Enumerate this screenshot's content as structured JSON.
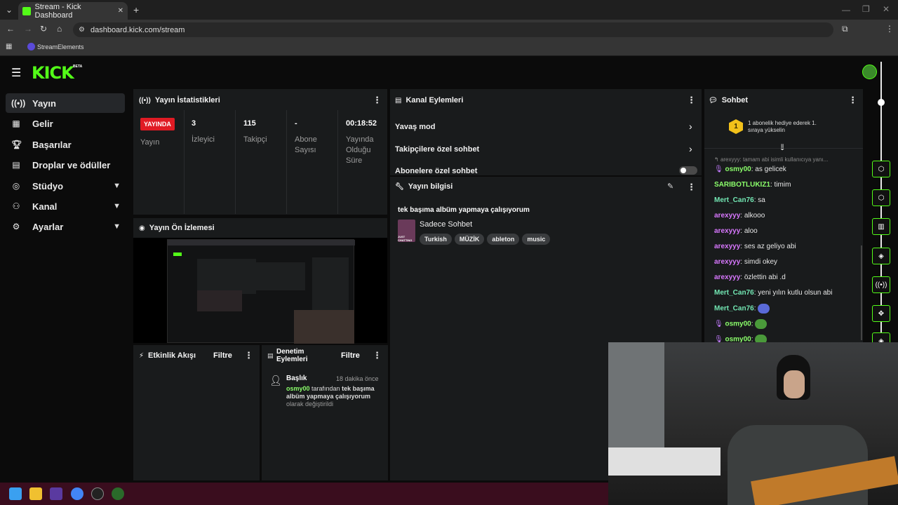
{
  "browser": {
    "tab_title": "Stream - Kick Dashboard",
    "url": "dashboard.kick.com/stream",
    "bookmark": "StreamElements",
    "new_tab": "+",
    "close_tab": "✕"
  },
  "header": {
    "logo": "KICK",
    "logo_badge": "BETA"
  },
  "sidebar": {
    "items": [
      {
        "label": "Yayın",
        "icon": "broadcast-icon",
        "active": true
      },
      {
        "label": "Gelir",
        "icon": "chart-icon"
      },
      {
        "label": "Başarılar",
        "icon": "trophy-icon"
      },
      {
        "label": "Droplar ve ödüller",
        "icon": "gift-icon"
      },
      {
        "label": "Stüdyo",
        "icon": "studio-icon",
        "expandable": true
      },
      {
        "label": "Kanal",
        "icon": "channel-icon",
        "expandable": true
      },
      {
        "label": "Ayarlar",
        "icon": "gear-icon",
        "expandable": true
      }
    ]
  },
  "stats": {
    "title": "Yayın İstatistikleri",
    "live_badge": "YAYINDA",
    "live_label": "Yayın",
    "viewers_value": "3",
    "viewers_label": "İzleyici",
    "followers_value": "115",
    "followers_label": "Takipçi",
    "subs_value": "-",
    "subs_label_1": "Abone",
    "subs_label_2": "Sayısı",
    "uptime_value": "00:18:52",
    "uptime_label_1": "Yayında",
    "uptime_label_2": "Olduğu",
    "uptime_label_3": "Süre"
  },
  "preview": {
    "title": "Yayın Ön İzlemesi"
  },
  "actions": {
    "title": "Kanal Eylemleri",
    "rows": [
      "Yavaş mod",
      "Takipçilere özel sohbet",
      "Abonelere özel sohbet"
    ]
  },
  "info": {
    "title": "Yayın bilgisi",
    "stream_title": "tek başıma albüm yapmaya çalışıyorum",
    "category": "Sadece Sohbet",
    "category_art": "JUST CHATTING",
    "tags": [
      "Turkish",
      "MÜZİK",
      "ableton",
      "music"
    ]
  },
  "activity": {
    "title": "Etkinlik Akışı",
    "filter": "Filtre"
  },
  "moderation": {
    "title_1": "Denetim",
    "title_2": "Eylemleri",
    "filter": "Filtre",
    "entry_title": "Başlık",
    "entry_time": "18 dakika önce",
    "entry_user": "osmy00",
    "entry_by": " tarafından ",
    "entry_value_1": "tek başıma",
    "entry_value_2": "albüm yapmaya çalışıyorum",
    "entry_suffix": "olarak değiştirildi"
  },
  "chat": {
    "title": "Sohbet",
    "gift_rank": "1",
    "gift_text_1": "1 abonelik hediye ederek 1.",
    "gift_text_2": "sıraya yükselin",
    "reply_preview": "arexyyy: tamam abi isimli kullanıcıya yanı...",
    "messages": [
      {
        "user": "osmy00",
        "text": " as gelicek",
        "badge": true
      },
      {
        "user": "SARIBOTLUKIZ1",
        "text": " timim"
      },
      {
        "user": "Mert_Can76",
        "text": " sa"
      },
      {
        "user": "arexyyy",
        "text": " alkooo"
      },
      {
        "user": "arexyyy",
        "text": " aloo"
      },
      {
        "user": "arexyyy",
        "text": " ses az geliyo abi"
      },
      {
        "user": "arexyyy",
        "text": " simdi okey"
      },
      {
        "user": "arexyyy",
        "text": " özlettin abi .d"
      },
      {
        "user": "Mert_Can76",
        "text": " yeni yılın kutlu olsun abi"
      },
      {
        "user": "Mert_Can76",
        "text": ""
      },
      {
        "user": "osmy00",
        "text": "",
        "badge": true
      },
      {
        "user": "osmy00",
        "text": "",
        "badge": true
      }
    ]
  },
  "colors": {
    "brand": "#53fc18",
    "live": "#e01b24",
    "panel": "#191b1c"
  }
}
